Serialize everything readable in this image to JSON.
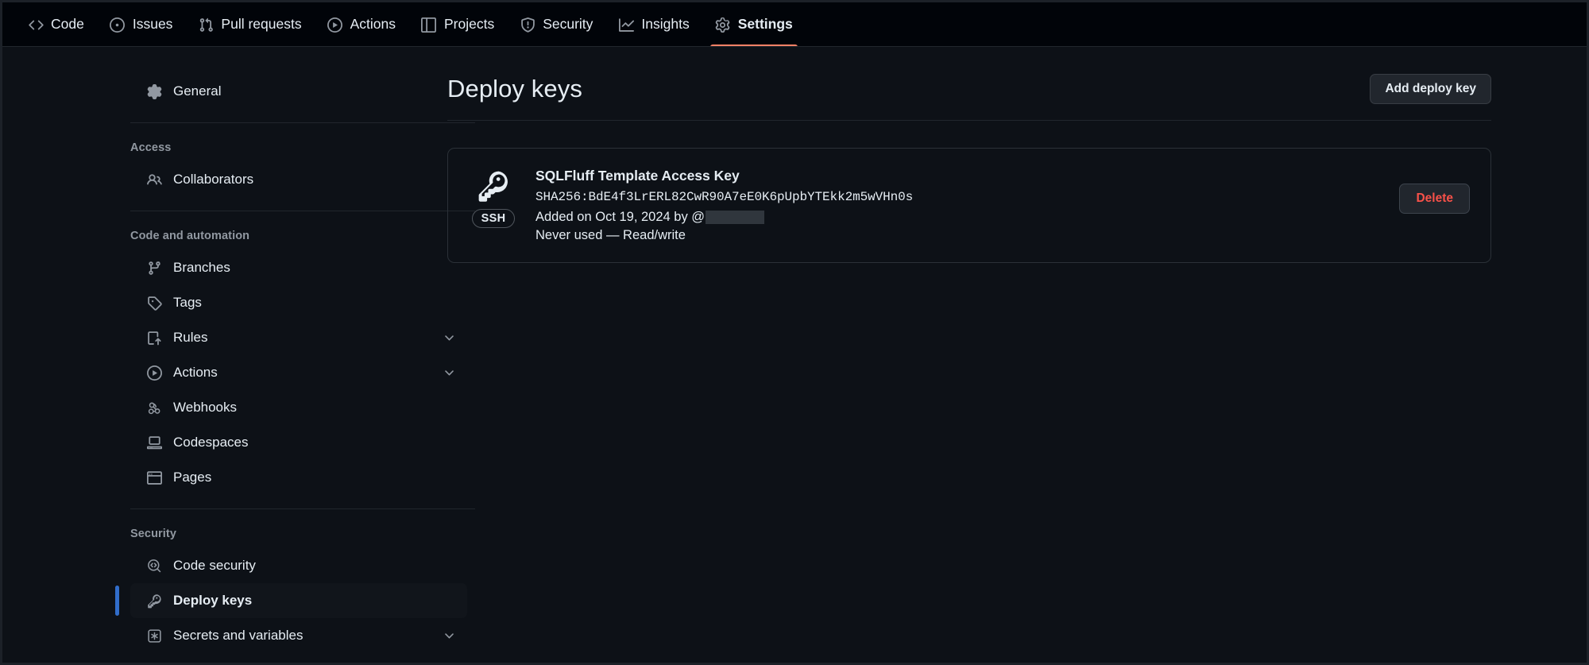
{
  "repo_nav": {
    "tabs": [
      {
        "label": "Code",
        "icon": "code-icon",
        "active": false
      },
      {
        "label": "Issues",
        "icon": "issue-opened-icon",
        "active": false
      },
      {
        "label": "Pull requests",
        "icon": "git-pull-request-icon",
        "active": false
      },
      {
        "label": "Actions",
        "icon": "play-icon",
        "active": false
      },
      {
        "label": "Projects",
        "icon": "table-icon",
        "active": false
      },
      {
        "label": "Security",
        "icon": "shield-icon",
        "active": false
      },
      {
        "label": "Insights",
        "icon": "graph-icon",
        "active": false
      },
      {
        "label": "Settings",
        "icon": "gear-icon",
        "active": true
      }
    ],
    "active_underline_color": "#f78166"
  },
  "sidebar": {
    "groups": [
      {
        "heading": null,
        "items": [
          {
            "label": "General",
            "icon": "gear-icon",
            "chevron": false,
            "current": false
          }
        ]
      },
      {
        "heading": "Access",
        "items": [
          {
            "label": "Collaborators",
            "icon": "people-icon",
            "chevron": false,
            "current": false
          }
        ]
      },
      {
        "heading": "Code and automation",
        "items": [
          {
            "label": "Branches",
            "icon": "git-branch-icon",
            "chevron": false,
            "current": false
          },
          {
            "label": "Tags",
            "icon": "tag-icon",
            "chevron": false,
            "current": false
          },
          {
            "label": "Rules",
            "icon": "rules-icon",
            "chevron": true,
            "current": false
          },
          {
            "label": "Actions",
            "icon": "play-icon",
            "chevron": true,
            "current": false
          },
          {
            "label": "Webhooks",
            "icon": "webhook-icon",
            "chevron": false,
            "current": false
          },
          {
            "label": "Codespaces",
            "icon": "codespaces-icon",
            "chevron": false,
            "current": false
          },
          {
            "label": "Pages",
            "icon": "browser-icon",
            "chevron": false,
            "current": false
          }
        ]
      },
      {
        "heading": "Security",
        "items": [
          {
            "label": "Code security",
            "icon": "codescan-icon",
            "chevron": false,
            "current": false
          },
          {
            "label": "Deploy keys",
            "icon": "key-icon",
            "chevron": false,
            "current": true
          },
          {
            "label": "Secrets and variables",
            "icon": "asterisk-icon",
            "chevron": true,
            "current": false
          }
        ]
      }
    ],
    "selected_indicator_color": "#316dca"
  },
  "main": {
    "page_title": "Deploy keys",
    "add_button_label": "Add deploy key",
    "keys": [
      {
        "name": "SQLFluff Template Access Key",
        "fingerprint": "SHA256:BdE4f3LrERL82CwR90A7eE0K6pUpbYTEkk2m5wVHn0s",
        "badge": "SSH",
        "added_prefix": "Added on Oct 19, 2024 by @",
        "added_user_redacted": true,
        "status": "Never used — Read/write",
        "delete_label": "Delete",
        "delete_color": "#f85149"
      }
    ]
  }
}
